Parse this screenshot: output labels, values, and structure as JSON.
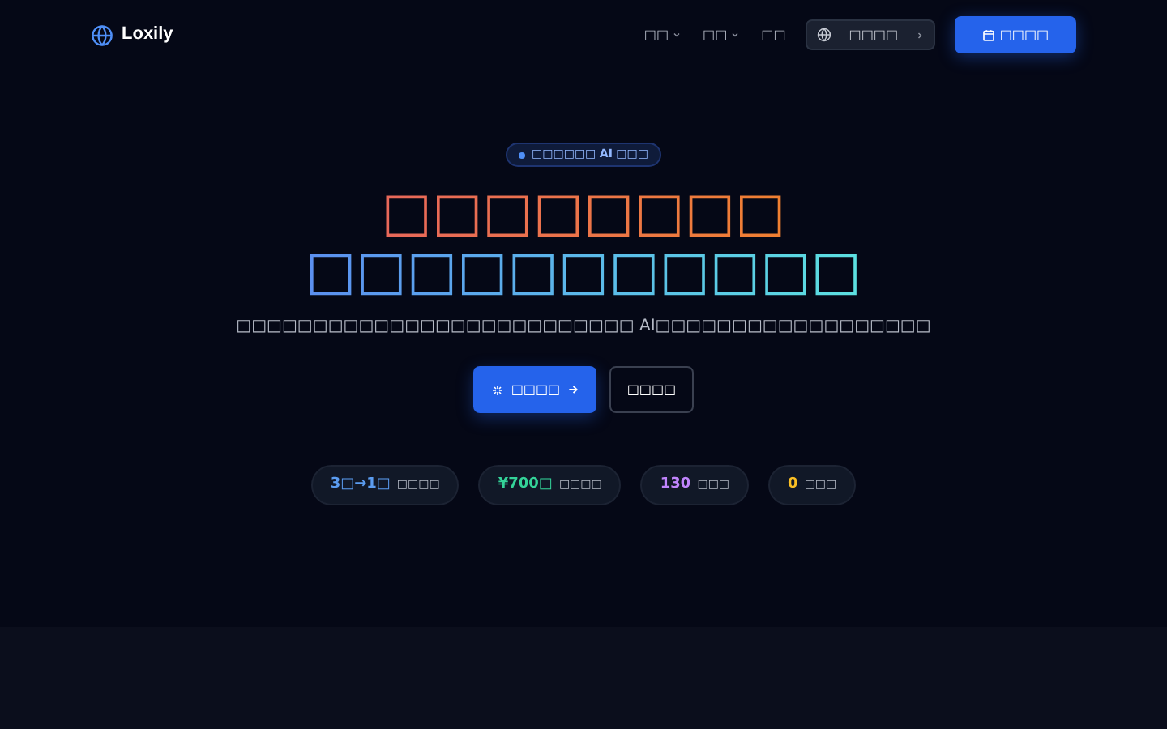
{
  "brand": "Loxily",
  "nav": [
    {
      "label": "□□",
      "dropdown": true
    },
    {
      "label": "□□",
      "dropdown": true
    },
    {
      "label": "□□",
      "dropdown": false
    }
  ],
  "language_button": "□□□□",
  "cta_button": "□□□□",
  "badge": "□□□□□□ **AI** □□□",
  "headline": [
    "□□□□□□□□",
    "□□□□□□□□□□□"
  ],
  "subtitle": "□□□□□□□□□□□□□□□□□□□□□□□□□□ AI□□□□□□□□□□□□□□□□□□",
  "primary_button": "□□□□",
  "secondary_button": "□□□□",
  "stats": [
    {
      "value": "3□→1□",
      "label": "□□□□",
      "color": "#5b9cf0"
    },
    {
      "value": "¥700□",
      "label": "□□□□",
      "color": "#34d399"
    },
    {
      "value": "130",
      "label": "□□□",
      "color": "#c084fc"
    },
    {
      "value": "0",
      "label": "□□□",
      "color": "#fbbf24"
    }
  ]
}
